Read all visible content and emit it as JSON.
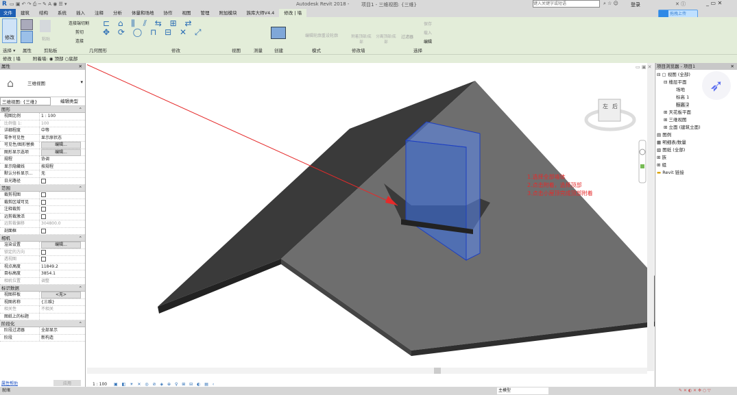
{
  "title": {
    "app_title": "Autodesk Revit 2018 -",
    "doc_title": "项目1 - 三维视图: {三维}",
    "search_placeholder": "键入关键字或短语",
    "login": "登录",
    "upload": "拖拽上传"
  },
  "tabs": [
    "建筑",
    "结构",
    "系统",
    "插入",
    "注释",
    "分析",
    "体量和场地",
    "协作",
    "视图",
    "管理",
    "附加模块",
    "族库大师V4.4",
    "修改 | 墙"
  ],
  "ribbon": {
    "modify": "修改",
    "paste": "粘贴",
    "cut_join": "连接端切割",
    "cut": "剪切",
    "join": "连接",
    "edit_profile": "编辑轮廓",
    "reset_profile": "重设轮廓",
    "attach": "附着顶部/底部",
    "detach": "分离顶部/底部",
    "filter": "过滤器",
    "save": "保存",
    "load": "载入",
    "edit": "编辑",
    "panels": [
      "选择 ▾",
      "属性",
      "剪贴板",
      "几何图形",
      "修改",
      "视图",
      "测量",
      "创建",
      "模式",
      "修改墙",
      "选择"
    ]
  },
  "options": {
    "context": "修改 | 墙",
    "attach_label": "附着墙:",
    "top": "顶部",
    "bottom": "底部"
  },
  "properties": {
    "title": "属性",
    "type": "三维视图",
    "selector": "三维视图: {三维}",
    "edit_type": "编辑类型",
    "groups": [
      {
        "name": "图形",
        "rows": [
          [
            "视图比例",
            "1 : 100"
          ],
          [
            "比例值 1:",
            "100"
          ],
          [
            "详细程度",
            "中等"
          ],
          [
            "零件可见性",
            "显示原状态"
          ],
          [
            "可见性/图形替换",
            "编辑..."
          ],
          [
            "图形显示选项",
            "编辑..."
          ],
          [
            "规程",
            "协调"
          ],
          [
            "显示隐藏线",
            "按规程"
          ],
          [
            "默认分析显示...",
            "无"
          ],
          [
            "日光路径",
            ""
          ]
        ]
      },
      {
        "name": "范围",
        "rows": [
          [
            "裁剪视图",
            ""
          ],
          [
            "裁剪区域可见",
            ""
          ],
          [
            "注释裁剪",
            ""
          ],
          [
            "远剪裁激活",
            ""
          ],
          [
            "远剪裁偏移",
            "304800.0"
          ],
          [
            "剖面框",
            ""
          ]
        ]
      },
      {
        "name": "相机",
        "rows": [
          [
            "渲染设置",
            "编辑..."
          ],
          [
            "锁定的方向",
            ""
          ],
          [
            "透视图",
            ""
          ],
          [
            "视点高度",
            "11849.2"
          ],
          [
            "目标高度",
            "3854.1"
          ],
          [
            "相机位置",
            "调整"
          ]
        ]
      },
      {
        "name": "标识数据",
        "rows": [
          [
            "视图样板",
            "<无>"
          ],
          [
            "视图名称",
            "{三维}"
          ],
          [
            "相关性",
            "不相关"
          ],
          [
            "图纸上的标题",
            ""
          ]
        ]
      },
      {
        "name": "阶段化",
        "rows": [
          [
            "阶段过滤器",
            "全部显示"
          ],
          [
            "阶段",
            "新构造"
          ]
        ]
      }
    ],
    "help": "属性帮助",
    "apply": "应用"
  },
  "browser": {
    "title": "项目浏览器 - 项目1",
    "items": [
      "视图 (全部)",
      "楼层平面",
      "场地",
      "标高 1",
      "标高 2",
      "天花板平面",
      "三维视图",
      "立面 (建筑立面)",
      "图例",
      "明细表/数量",
      "图纸 (全部)",
      "族",
      "组",
      "Revit 链接"
    ]
  },
  "annotations": [
    "1.选择全部墙体",
    "2.点击附着，选择顶部",
    "3.点击小屋顶完成顶部附着"
  ],
  "viewcube": {
    "face": "左",
    "face2": "后"
  },
  "status": {
    "scale": "1 : 100",
    "ready": "就绪",
    "model": "主模型"
  },
  "colors": {
    "accent_red": "#e52a2a",
    "ribbon_bg": "#e3edd9",
    "wall_blue": "#3c6fe0"
  }
}
